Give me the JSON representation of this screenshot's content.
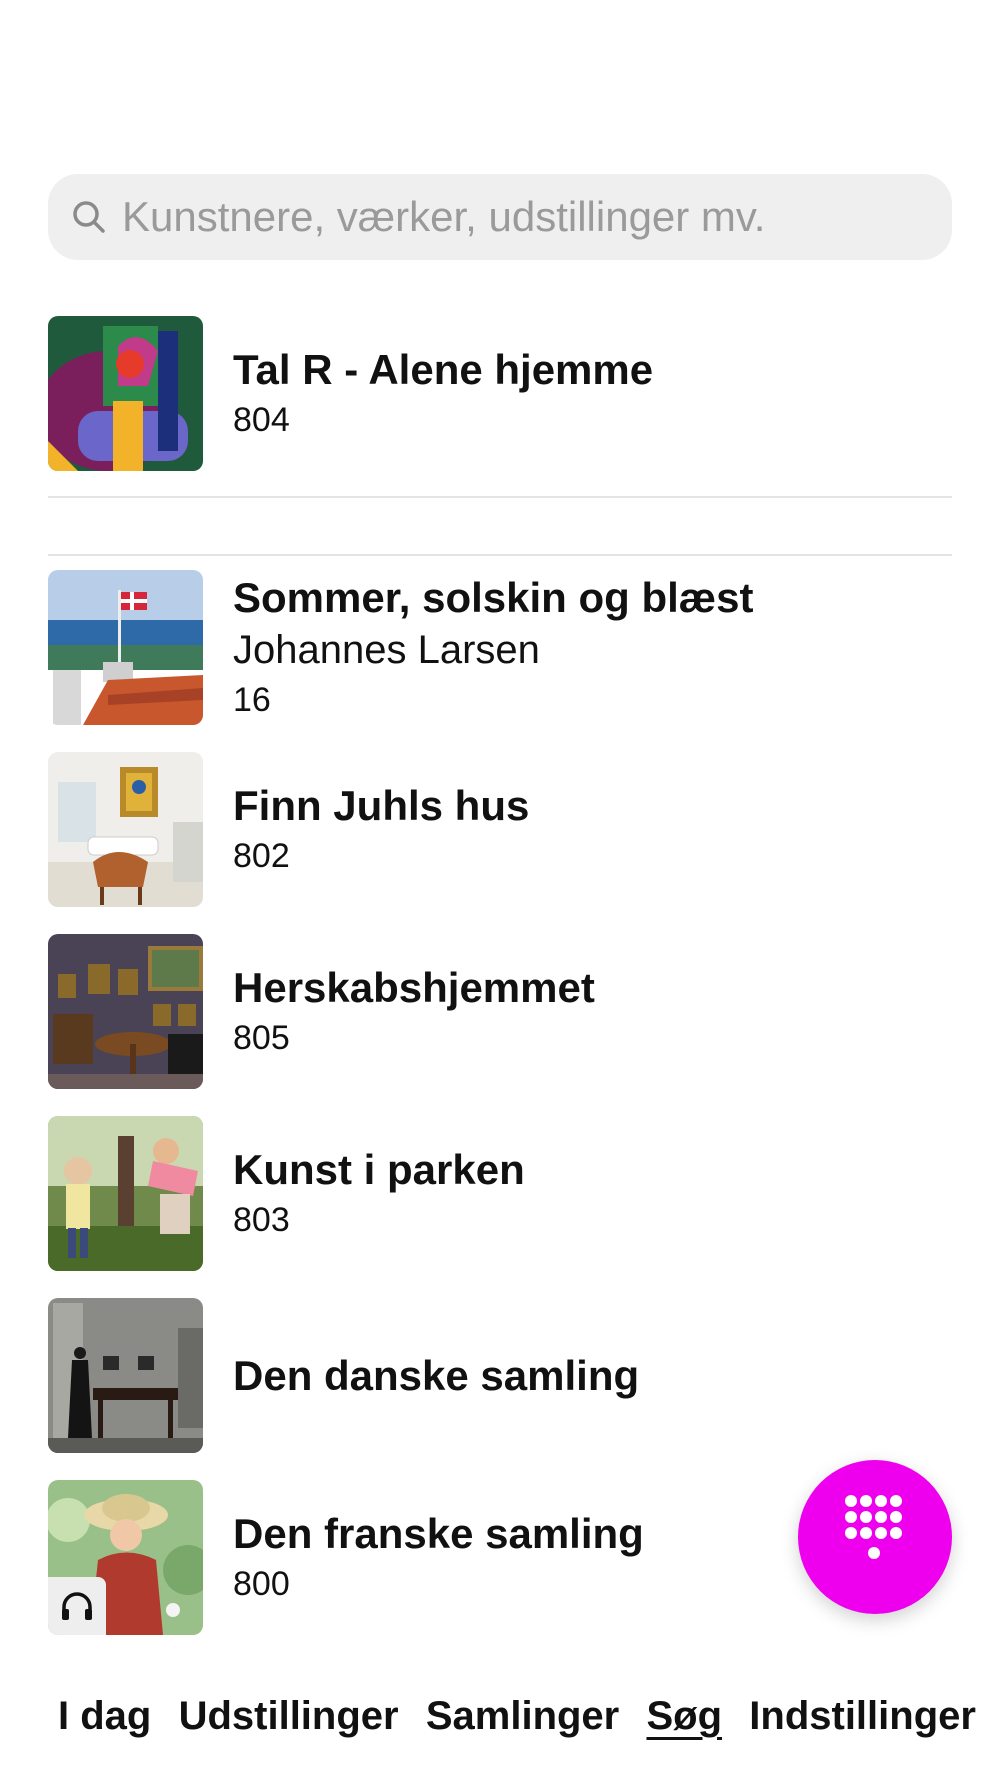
{
  "search": {
    "placeholder": "Kunstnere, værker, udstillinger mv.",
    "icon": "search-icon"
  },
  "featured": {
    "title": "Tal R - Alene hjemme",
    "number": "804"
  },
  "items": [
    {
      "title": "Sommer, solskin og blæst",
      "subtitle": "Johannes Larsen",
      "number": "16"
    },
    {
      "title": "Finn Juhls hus",
      "number": "802"
    },
    {
      "title": "Herskabshjemmet",
      "number": "805"
    },
    {
      "title": "Kunst i parken",
      "number": "803"
    },
    {
      "title": "Den danske samling"
    },
    {
      "title": "Den franske samling",
      "number": "800",
      "badge_icon": "headphones-icon"
    }
  ],
  "fab": {
    "icon": "keypad-icon",
    "color": "#ee00ee"
  },
  "tabs": [
    {
      "label": "I dag"
    },
    {
      "label": "Udstillinger"
    },
    {
      "label": "Samlinger"
    },
    {
      "label": "Søg",
      "active": true
    },
    {
      "label": "Indstillinger"
    }
  ]
}
